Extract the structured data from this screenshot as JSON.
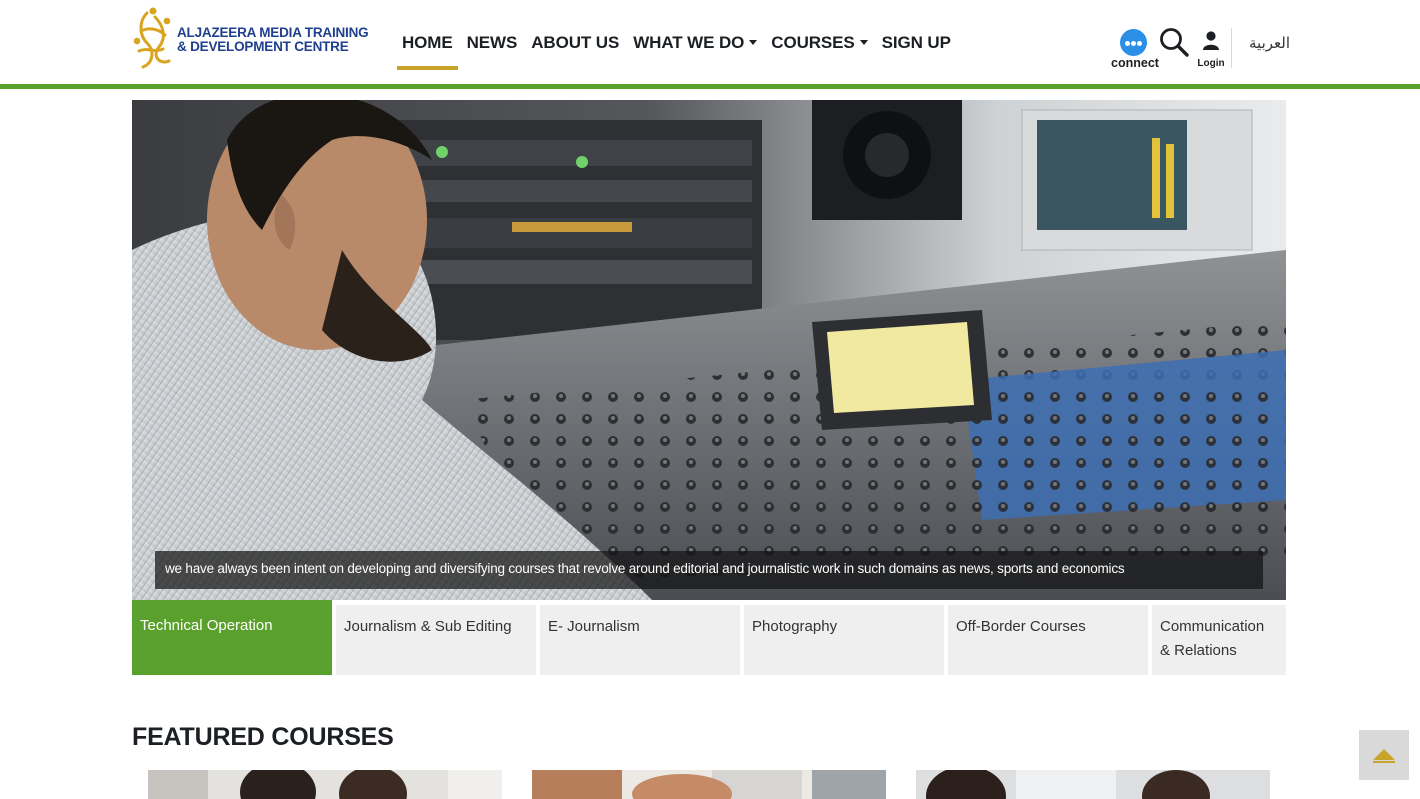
{
  "header": {
    "logo": {
      "line1": "ALJAZEERA MEDIA TRAINING",
      "line2": "& DEVELOPMENT CENTRE"
    },
    "nav": [
      {
        "label": "HOME",
        "active": true,
        "dropdown": false
      },
      {
        "label": "NEWS",
        "active": false,
        "dropdown": false
      },
      {
        "label": "ABOUT US",
        "active": false,
        "dropdown": false
      },
      {
        "label": "WHAT WE DO",
        "active": false,
        "dropdown": true
      },
      {
        "label": "COURSES",
        "active": false,
        "dropdown": true
      },
      {
        "label": "SIGN UP",
        "active": false,
        "dropdown": false
      }
    ],
    "connect_label": "connect",
    "login_label": "Login",
    "language_label": "العربية",
    "icons": {
      "connect": "chat-bubble-icon",
      "search": "search-icon",
      "login": "user-icon"
    }
  },
  "hero": {
    "caption": "we have always been intent on developing and diversifying courses that revolve around editorial and journalistic work in such domains as news, sports and economics"
  },
  "category_tabs": [
    {
      "label": "Technical Operation",
      "active": true
    },
    {
      "label": "Journalism & Sub Editing",
      "active": false
    },
    {
      "label": "E- Journalism",
      "active": false
    },
    {
      "label": "Photography",
      "active": false
    },
    {
      "label": "Off-Border Courses",
      "active": false
    },
    {
      "label": "Communication & Relations",
      "active": false
    }
  ],
  "featured": {
    "title": "FEATURED COURSES"
  },
  "colors": {
    "brand_green": "#5aa02c",
    "brand_gold": "#c9a42a",
    "logo_blue": "#1f3f8f",
    "connect_blue": "#2b8fe8"
  }
}
